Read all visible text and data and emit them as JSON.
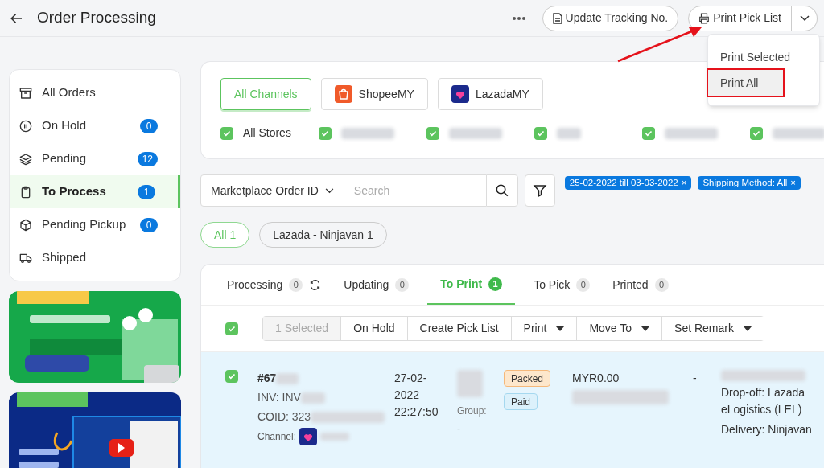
{
  "header": {
    "title": "Order Processing",
    "update_button": "Update Tracking No.",
    "print_button": "Print Pick List"
  },
  "print_menu": [
    {
      "label": "Print Selected",
      "selected": false
    },
    {
      "label": "Print All",
      "selected": true
    }
  ],
  "sidebar": {
    "items": [
      {
        "label": "All Orders",
        "selected": false
      },
      {
        "label": "On Hold",
        "badge": "0",
        "selected": false
      },
      {
        "label": "Pending",
        "badge": "12",
        "selected": false
      },
      {
        "label": "To Process",
        "badge": "1",
        "selected": true
      },
      {
        "label": "Pending Pickup",
        "badge": "0",
        "selected": false
      },
      {
        "label": "Shipped",
        "selected": false
      }
    ]
  },
  "channels": [
    {
      "label": "All Channels",
      "selected": true
    },
    {
      "label": "ShopeeMY",
      "selected": false
    },
    {
      "label": "LazadaMY",
      "selected": false
    }
  ],
  "stores": [
    {
      "label": "All Stores",
      "checked": true
    },
    {
      "checked": true
    },
    {
      "checked": true
    },
    {
      "checked": true
    },
    {
      "checked": true
    },
    {
      "checked": true
    }
  ],
  "search": {
    "field": "Marketplace Order ID",
    "placeholder": "Search"
  },
  "filters": [
    {
      "label": "25-02-2022 till 03-03-2022",
      "close": "×"
    },
    {
      "label": "Shipping Method: All",
      "close": "×"
    }
  ],
  "groups": [
    {
      "label": "All 1",
      "selected": true
    },
    {
      "label": "Lazada - Ninjavan 1",
      "selected": false
    }
  ],
  "tabs": [
    {
      "label": "Processing",
      "count": "0",
      "refresh": true,
      "selected": false
    },
    {
      "label": "Updating",
      "count": "0",
      "refresh": false,
      "selected": false
    },
    {
      "label": "To Print",
      "count": "1",
      "refresh": false,
      "selected": true
    },
    {
      "label": "To Pick",
      "count": "0",
      "refresh": false,
      "selected": false
    },
    {
      "label": "Printed",
      "count": "0",
      "refresh": false,
      "selected": false
    }
  ],
  "bulk": {
    "checked": true,
    "actions": [
      {
        "label": "1 Selected",
        "disabled": true,
        "caret": false
      },
      {
        "label": "On Hold",
        "disabled": false,
        "caret": false
      },
      {
        "label": "Create Pick List",
        "disabled": false,
        "caret": false
      },
      {
        "label": "Print",
        "disabled": false,
        "caret": true
      },
      {
        "label": "Move To",
        "disabled": false,
        "caret": true
      },
      {
        "label": "Set Remark",
        "disabled": false,
        "caret": true
      }
    ]
  },
  "order": {
    "checked": true,
    "id": "#67",
    "inv": "INV: INV",
    "coid": "COID: 323",
    "channel": "Channel:",
    "date": "27-02-2022 22:27:50",
    "group_label": "Group:",
    "group_value": "-",
    "tags": [
      {
        "label": "Packed",
        "kind": "packed"
      },
      {
        "label": "Paid",
        "kind": "paid"
      }
    ],
    "amount": "MYR0.00",
    "dash": "-",
    "shipping": [
      "Drop-off: Lazada eLogistics (LEL)",
      "Delivery: Ninjavan"
    ]
  }
}
